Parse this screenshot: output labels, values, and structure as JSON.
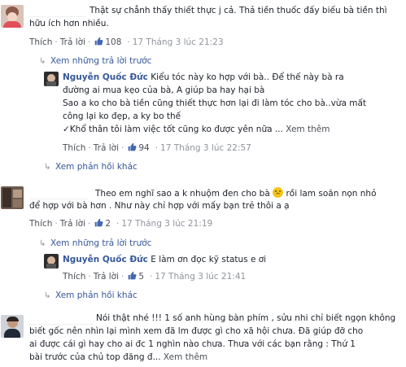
{
  "comments": [
    {
      "text_lines": [
        "Thật sự chẳnh thấy thiết thực j cả. Thả tiền thuốc đấy biếu bà tiền thì",
        "hữu ích hơn nhiều."
      ],
      "meta": {
        "like": "Thích",
        "reply": "Trả lời",
        "likes": "108",
        "time": "17 Tháng 3 lúc 21:23"
      },
      "view_more_replies": "Xem những trả lời trước",
      "reply": {
        "author": "Nguyễn Quốc Đức",
        "first_line": "Kiểu tóc này ko hợp với bà.. Để thế này bà ra",
        "lines": [
          "đường ai mua kẹo của bà, A giúp ba hay hại bà",
          "Sao a ko cho bà tiền cũng thiết thực hơn lại đi làm tóc cho bà..vừa mất",
          "công lại ko đẹp, a ky bo thế",
          "✓Khổ thân tôi làm việc tốt cũng ko được yên nữa ..."
        ],
        "see_more": "Xem thêm",
        "meta": {
          "like": "Thích",
          "reply": "Trả lời",
          "likes": "94",
          "time": "17 Tháng 3 lúc 22:57"
        }
      },
      "view_replies": "Xem phản hồi khác"
    },
    {
      "text_lines": [
        "Theo em nghĩ sao a k nhuộm đen cho bà",
        "rồi lam soăn nọn nhỏ",
        "để hợp với bà hơn . Như này chỉ hợp với mấy bạn trẻ thôi a ạ"
      ],
      "meta": {
        "like": "Thích",
        "reply": "Trả lời",
        "likes": "2",
        "time": "17 Tháng 3 lúc 21:19"
      },
      "view_more_replies": "Xem những trả lời trước",
      "reply": {
        "author": "Nguyễn Quốc Đức",
        "first_line": "E làm ơn đọc kỹ status e ơi",
        "meta": {
          "like": "Thích",
          "reply": "Trả lời",
          "likes": "5",
          "time": "17 Tháng 3 lúc 21:41"
        }
      },
      "view_replies": "Xem phản hồi khác"
    },
    {
      "text_lines": [
        "Nói thật nhé !!! 1 số anh hùng bàn phím , sửu nhi chỉ biết ngọn không",
        "biết gốc nên nhìn lại mình xem đã lm được gì cho xã hội chưa. Đã giúp đỡ cho",
        "ai được cái gì hay cho ai đc 1 nghìn nào chưa. Thưa với các bạn rằng : Thứ 1",
        "bài trước của chủ top đăng đ..."
      ],
      "see_more": "Xem thêm"
    }
  ],
  "colors": {
    "link": "#365899",
    "meta": "#90949c",
    "like_blue": "#4267b2"
  }
}
